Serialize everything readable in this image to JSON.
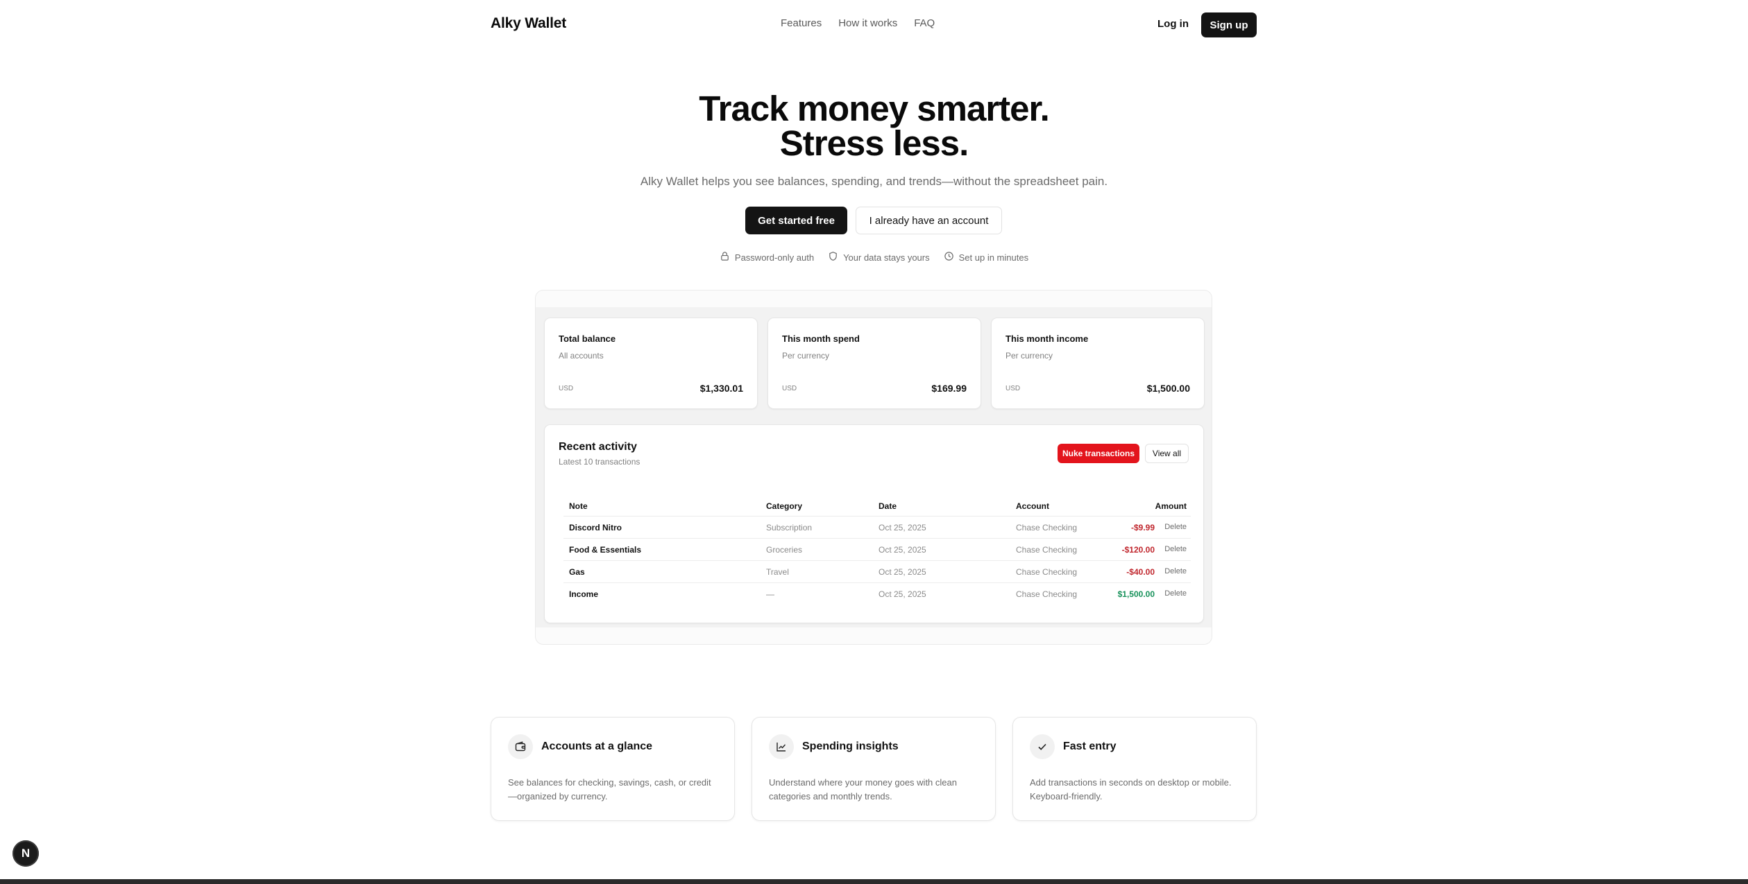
{
  "header": {
    "brand": "Alky Wallet",
    "nav": [
      "Features",
      "How it works",
      "FAQ"
    ],
    "login": "Log in",
    "signup": "Sign up"
  },
  "hero": {
    "title_line1": "Track money smarter.",
    "title_line2": "Stress less.",
    "subtitle": "Alky Wallet helps you see balances, spending, and trends—without the spreadsheet pain.",
    "cta_primary": "Get started free",
    "cta_secondary": "I already have an account",
    "trust": [
      {
        "icon": "lock-icon",
        "label": "Password-only auth"
      },
      {
        "icon": "shield-icon",
        "label": "Your data stays yours"
      },
      {
        "icon": "clock-icon",
        "label": "Set up in minutes"
      }
    ]
  },
  "stats": [
    {
      "title": "Total balance",
      "subtitle": "All accounts",
      "currency": "USD",
      "value": "$1,330.01"
    },
    {
      "title": "This month spend",
      "subtitle": "Per currency",
      "currency": "USD",
      "value": "$169.99"
    },
    {
      "title": "This month income",
      "subtitle": "Per currency",
      "currency": "USD",
      "value": "$1,500.00"
    }
  ],
  "activity": {
    "title": "Recent activity",
    "subtitle": "Latest 10 transactions",
    "nuke": "Nuke transactions",
    "view_all": "View all",
    "columns": [
      "Note",
      "Category",
      "Date",
      "Account",
      "Amount"
    ],
    "rows": [
      {
        "note": "Discord Nitro",
        "category": "Subscription",
        "date": "Oct 25, 2025",
        "account": "Chase Checking",
        "amount": "-$9.99",
        "delete": "Delete"
      },
      {
        "note": "Food & Essentials",
        "category": "Groceries",
        "date": "Oct 25, 2025",
        "account": "Chase Checking",
        "amount": "-$120.00",
        "delete": "Delete"
      },
      {
        "note": "Gas",
        "category": "Travel",
        "date": "Oct 25, 2025",
        "account": "Chase Checking",
        "amount": "-$40.00",
        "delete": "Delete"
      },
      {
        "note": "Income",
        "category": "—",
        "date": "Oct 25, 2025",
        "account": "Chase Checking",
        "amount": "$1,500.00",
        "delete": "Delete"
      }
    ]
  },
  "features": [
    {
      "icon": "wallet-icon",
      "title": "Accounts at a glance",
      "desc": "See balances for checking, savings, cash, or credit—organized by currency."
    },
    {
      "icon": "chart-icon",
      "title": "Spending insights",
      "desc": "Understand where your money goes with clean categories and monthly trends."
    },
    {
      "icon": "check-icon",
      "title": "Fast entry",
      "desc": "Add transactions in seconds on desktop or mobile. Keyboard-friendly."
    }
  ],
  "badge": "N",
  "colors": {
    "primary": "#141414",
    "danger": "#e3141c",
    "negative": "#c0262d",
    "positive": "#17915a"
  }
}
